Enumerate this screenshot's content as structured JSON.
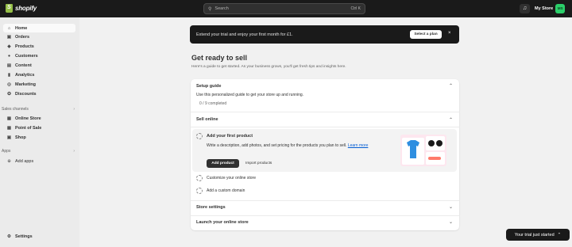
{
  "brand": {
    "name": "shopify"
  },
  "search": {
    "placeholder": "Search",
    "shortcut": "Ctrl K"
  },
  "store": {
    "name": "My Store",
    "initials": "MS"
  },
  "sidebar": {
    "items": [
      {
        "label": "Home",
        "icon": "home-icon",
        "glyph": "⌂"
      },
      {
        "label": "Orders",
        "icon": "inbox-icon",
        "glyph": "▣"
      },
      {
        "label": "Products",
        "icon": "tag-icon",
        "glyph": "◆"
      },
      {
        "label": "Customers",
        "icon": "person-icon",
        "glyph": "●"
      },
      {
        "label": "Content",
        "icon": "content-icon",
        "glyph": "▤"
      },
      {
        "label": "Analytics",
        "icon": "bar-chart-icon",
        "glyph": "▮"
      },
      {
        "label": "Marketing",
        "icon": "target-icon",
        "glyph": "◎"
      },
      {
        "label": "Discounts",
        "icon": "discount-icon",
        "glyph": "✪"
      }
    ],
    "sales_channels_label": "Sales channels",
    "channels": [
      {
        "label": "Online Store",
        "icon": "store-icon",
        "glyph": "▦"
      },
      {
        "label": "Point of Sale",
        "icon": "pos-icon",
        "glyph": "▦"
      },
      {
        "label": "Shop",
        "icon": "shop-icon",
        "glyph": "▣"
      }
    ],
    "apps_label": "Apps",
    "add_apps": "Add apps",
    "settings": "Settings"
  },
  "banner": {
    "text": "Extend your trial and enjoy your first month for £1.",
    "button": "Select a plan",
    "close": "×"
  },
  "main": {
    "title": "Get ready to sell",
    "subtitle": "Here's a guide to get started. As your business grows, you'll get fresh tips and insights here."
  },
  "guide": {
    "title": "Setup guide",
    "description": "Use this personalized guide to get your store up and running.",
    "progress": "0 / 9 completed",
    "sell_online": "Sell online",
    "task_title": "Add your first product",
    "task_desc": "Write a description, add photos, and set pricing for the products you plan to sell.",
    "learn_more": "Learn more",
    "add_product": "Add product",
    "import_products": "Import products",
    "customize": "Customize your online store",
    "custom_domain": "Add a custom domain",
    "store_settings": "Store settings",
    "launch": "Launch your online store"
  },
  "trial": {
    "label": "Your trial just started",
    "chevron": "⌃"
  },
  "colors": {
    "accent": "#95bf47",
    "dark": "#1a1a1a",
    "link": "#005bd3",
    "avatar": "#2bcf6a"
  }
}
